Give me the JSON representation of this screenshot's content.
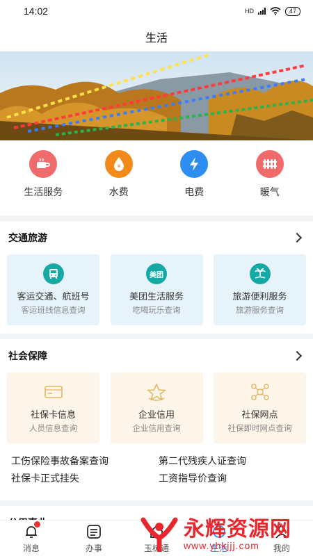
{
  "status_bar": {
    "time": "14:02",
    "network": "HD",
    "battery": "47"
  },
  "nav": {
    "title": "生活"
  },
  "quick_services": [
    {
      "label": "生活服务",
      "icon": "cup-icon",
      "color": "#ef6b6b"
    },
    {
      "label": "水费",
      "icon": "water-drop-icon",
      "color": "#f28a1a"
    },
    {
      "label": "电费",
      "icon": "lightning-icon",
      "color": "#2d8ef0"
    },
    {
      "label": "暖气",
      "icon": "radiator-icon",
      "color": "#ef6b6b"
    }
  ],
  "transport": {
    "title": "交通旅游",
    "cards": [
      {
        "title": "客运交通、航班号",
        "sub": "客运班线信息查询",
        "icon": "bus-icon"
      },
      {
        "title": "美团生活服务",
        "sub": "吃喝玩乐查询",
        "icon": "meituan-icon",
        "icon_text": "美团"
      },
      {
        "title": "旅游便利服务",
        "sub": "旅游服务查询",
        "icon": "island-icon"
      }
    ]
  },
  "social": {
    "title": "社会保障",
    "cards": [
      {
        "title": "社保卡信息",
        "sub": "人员信息查询",
        "icon": "card-icon"
      },
      {
        "title": "企业信用",
        "sub": "企业信用查询",
        "icon": "star-icon"
      },
      {
        "title": "社保网点",
        "sub": "社保即时网点查询",
        "icon": "network-icon"
      }
    ],
    "links": [
      "工伤保险事故备案查询",
      "第二代残疾人证查询",
      "社保卡正式挂失",
      "工资指导价查询"
    ]
  },
  "next_section": {
    "title": "公用事业"
  },
  "tabbar": [
    {
      "label": "消息",
      "icon": "bell-icon",
      "badge": true
    },
    {
      "label": "办事",
      "icon": "list-icon"
    },
    {
      "label": "玉树通",
      "icon": "home-icon"
    },
    {
      "label": "生活",
      "icon": "life-icon",
      "active": true
    },
    {
      "label": "我的",
      "icon": "user-icon"
    }
  ],
  "watermark": {
    "main": "永辉资源网",
    "url": "www.yhkjjj.com"
  }
}
